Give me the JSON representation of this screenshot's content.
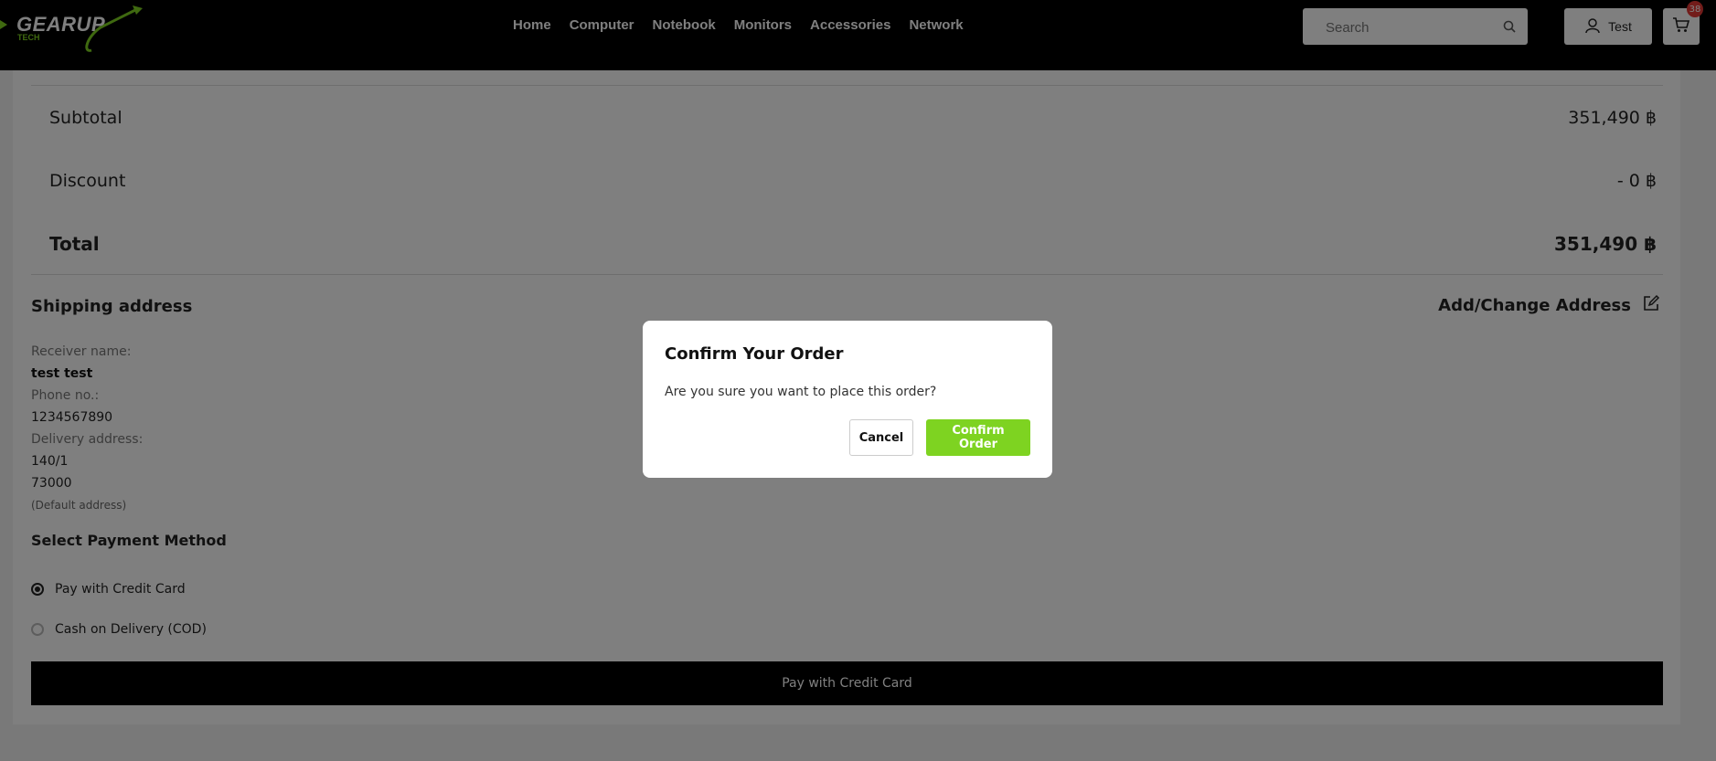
{
  "header": {
    "logo": "GEARUP",
    "logo_sub": "TECH",
    "nav": [
      "Home",
      "Computer",
      "Notebook",
      "Monitors",
      "Accessories",
      "Network"
    ],
    "search_placeholder": "Search",
    "user_label": "Test",
    "cart_count": "38"
  },
  "summary": {
    "subtotal_label": "Subtotal",
    "subtotal_value": "351,490 ฿",
    "discount_label": "Discount",
    "discount_value": "- 0 ฿",
    "total_label": "Total",
    "total_value": "351,490 ฿"
  },
  "shipping": {
    "title": "Shipping address",
    "change_label": "Add/Change Address",
    "receiver_label": "Receiver name:",
    "receiver_value": "test test",
    "phone_label": "Phone no.:",
    "phone_value": "1234567890",
    "address_label": "Delivery address:",
    "address_line1": "140/1",
    "address_line2": "73000",
    "default_note": "(Default address)"
  },
  "payment": {
    "title": "Select Payment Method",
    "options": [
      {
        "label": "Pay with Credit Card",
        "selected": true
      },
      {
        "label": "Cash on Delivery (COD)",
        "selected": false
      }
    ],
    "submit_label": "Pay with Credit Card"
  },
  "modal": {
    "title": "Confirm Your Order",
    "message": "Are you sure you want to place this order?",
    "cancel_label": "Cancel",
    "confirm_label": "Confirm Order"
  },
  "colors": {
    "accent": "#7ed321",
    "header_bg": "#000000",
    "badge": "#e53935"
  }
}
